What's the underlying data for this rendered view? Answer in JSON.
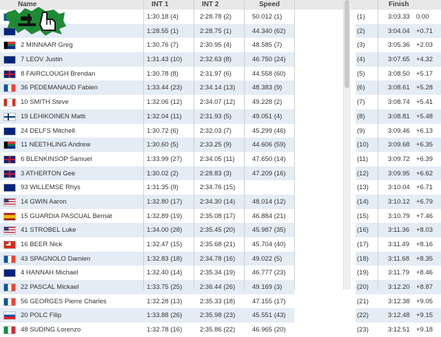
{
  "headers": {
    "name": "Name",
    "int1": "INT 1",
    "int2": "INT 2",
    "speed": "Speed",
    "finish": "Finish"
  },
  "flag_colors": {
    "fr": [
      "#0055a4",
      "#ffffff",
      "#ef4135"
    ],
    "au": [
      "#00247d",
      "#00247d",
      "#cc0000"
    ],
    "za": [
      "#007a4d",
      "#ffb612",
      "#de3831"
    ],
    "gb": [
      "#00247d",
      "#cf142b",
      "#00247d"
    ],
    "ca": [
      "#d52b1e",
      "#ffffff",
      "#d52b1e"
    ],
    "fi": [
      "#ffffff",
      "#003580",
      "#ffffff"
    ],
    "us": [
      "#b22234",
      "#ffffff",
      "#3c3b6e"
    ],
    "es": [
      "#aa151b",
      "#f1bf00",
      "#aa151b"
    ],
    "ch": [
      "#d52b1e",
      "#ffffff",
      "#d52b1e"
    ],
    "sk": [
      "#ffffff",
      "#0b4ea2",
      "#ee1c25"
    ],
    "it": [
      "#009246",
      "#ffffff",
      "#ce2b37"
    ]
  },
  "rows": [
    {
      "flag": "fr",
      "name": "",
      "int1": "1:30.18 (4)",
      "int2": "2:28.78 (2)",
      "speed": "50.012 (1)",
      "rank": "(1)",
      "time": "3:03.33",
      "gap": "0.00"
    },
    {
      "flag": "au",
      "name": "",
      "int1": "1:28.55 (1)",
      "int2": "2:28.75 (1)",
      "speed": "44.340 (62)",
      "rank": "(2)",
      "time": "3:04.04",
      "gap": "+0.71"
    },
    {
      "flag": "za",
      "name": "2 MINNAAR Greg",
      "int1": "1:30.76 (7)",
      "int2": "2:30.95 (4)",
      "speed": "48.585 (7)",
      "rank": "(3)",
      "time": "3:05.36",
      "gap": "+2.03"
    },
    {
      "flag": "au",
      "name": "7 LEOV Justin",
      "int1": "1:31.43 (10)",
      "int2": "2:32.63 (8)",
      "speed": "46.750 (24)",
      "rank": "(4)",
      "time": "3:07.65",
      "gap": "+4.32"
    },
    {
      "flag": "gb",
      "name": "8 FAIRCLOUGH Brendan",
      "int1": "1:30.78 (8)",
      "int2": "2:31.97 (6)",
      "speed": "44.558 (60)",
      "rank": "(5)",
      "time": "3:08.50",
      "gap": "+5.17"
    },
    {
      "flag": "fr",
      "name": "36 PEDEMANAUD Fabien",
      "int1": "1:33.44 (23)",
      "int2": "2:34.14 (13)",
      "speed": "48.383 (9)",
      "rank": "(6)",
      "time": "3:08.61",
      "gap": "+5.28"
    },
    {
      "flag": "ca",
      "name": "10 SMITH Steve",
      "int1": "1:32.06 (12)",
      "int2": "2:34.07 (12)",
      "speed": "49.228 (2)",
      "rank": "(7)",
      "time": "3:08.74",
      "gap": "+5.41"
    },
    {
      "flag": "fi",
      "name": "19 LEHIKOINEN Matti",
      "int1": "1:32.04 (11)",
      "int2": "2:31.93 (5)",
      "speed": "49.051 (4)",
      "rank": "(8)",
      "time": "3:08.81",
      "gap": "+5.48"
    },
    {
      "flag": "au",
      "name": "24 DELFS Mitchell",
      "int1": "1:30.72 (6)",
      "int2": "2:32.03 (7)",
      "speed": "45.299 (46)",
      "rank": "(9)",
      "time": "3:09.46",
      "gap": "+6.13"
    },
    {
      "flag": "za",
      "name": "11 NEETHLING Andrew",
      "int1": "1:30.60 (5)",
      "int2": "2:33.25 (9)",
      "speed": "44.606 (59)",
      "rank": "(10)",
      "time": "3:09.68",
      "gap": "+6.35"
    },
    {
      "flag": "gb",
      "name": "6 BLENKINSOP Samuel",
      "int1": "1:33.99 (27)",
      "int2": "2:34.05 (11)",
      "speed": "47.650 (14)",
      "rank": "(11)",
      "time": "3:09.72",
      "gap": "+6.39"
    },
    {
      "flag": "gb",
      "name": "3 ATHERTON Gee",
      "int1": "1:30.02 (2)",
      "int2": "2:28.83 (3)",
      "speed": "47.209 (16)",
      "rank": "(12)",
      "time": "3:09.95",
      "gap": "+6.62"
    },
    {
      "flag": "au",
      "name": "93 WILLEMSE Rhys",
      "int1": "1:31.35 (9)",
      "int2": "2:34.76 (15)",
      "speed": "",
      "rank": "(13)",
      "time": "3:10.04",
      "gap": "+6.71"
    },
    {
      "flag": "us",
      "name": "14 GWIN Aaron",
      "int1": "1:32.80 (17)",
      "int2": "2:34.30 (14)",
      "speed": "48.014 (12)",
      "rank": "(14)",
      "time": "3:10.12",
      "gap": "+6.79"
    },
    {
      "flag": "es",
      "name": "15 GUARDIA PASCUAL Bernat",
      "int1": "1:32.89 (19)",
      "int2": "2:35.08 (17)",
      "speed": "46.884 (21)",
      "rank": "(15)",
      "time": "3:10.79",
      "gap": "+7.46"
    },
    {
      "flag": "us",
      "name": "41 STROBEL Luke",
      "int1": "1:34.00 (28)",
      "int2": "2:35.45 (20)",
      "speed": "45.987 (35)",
      "rank": "(16)",
      "time": "3:11.36",
      "gap": "+8.03"
    },
    {
      "flag": "ch",
      "name": "16 BEER Nick",
      "int1": "1:32.47 (15)",
      "int2": "2:35.68 (21)",
      "speed": "45.704 (40)",
      "rank": "(17)",
      "time": "3:11.49",
      "gap": "+8.16"
    },
    {
      "flag": "fr",
      "name": "43 SPAGNOLO Damien",
      "int1": "1:32.83 (18)",
      "int2": "2:34.78 (16)",
      "speed": "49.022 (5)",
      "rank": "(18)",
      "time": "3:11.68",
      "gap": "+8.35"
    },
    {
      "flag": "au",
      "name": "4 HANNAH Michael",
      "int1": "1:32.40 (14)",
      "int2": "2:35.34 (19)",
      "speed": "46.777 (23)",
      "rank": "(19)",
      "time": "3:11.79",
      "gap": "+8.46"
    },
    {
      "flag": "fr",
      "name": "22 PASCAL Mickael",
      "int1": "1:33.75 (25)",
      "int2": "2:36.44 (26)",
      "speed": "49.169 (3)",
      "rank": "(20)",
      "time": "3:12.20",
      "gap": "+8.87"
    },
    {
      "flag": "fr",
      "name": "56 GEORGES Pierre Charles",
      "int1": "1:32.28 (13)",
      "int2": "2:35.33 (18)",
      "speed": "47.155 (17)",
      "rank": "(21)",
      "time": "3:12.38",
      "gap": "+9.05"
    },
    {
      "flag": "sk",
      "name": "20 POLC Filip",
      "int1": "1:33.88 (26)",
      "int2": "2:35.98 (23)",
      "speed": "45.551 (43)",
      "rank": "(22)",
      "time": "3:12.48",
      "gap": "+9.15"
    },
    {
      "flag": "it",
      "name": "48 SUDING Lorenzo",
      "int1": "1:32.78 (16)",
      "int2": "2:35.86 (22)",
      "speed": "46.965 (20)",
      "rank": "(23)",
      "time": "3:12.51",
      "gap": "+9.18"
    }
  ]
}
